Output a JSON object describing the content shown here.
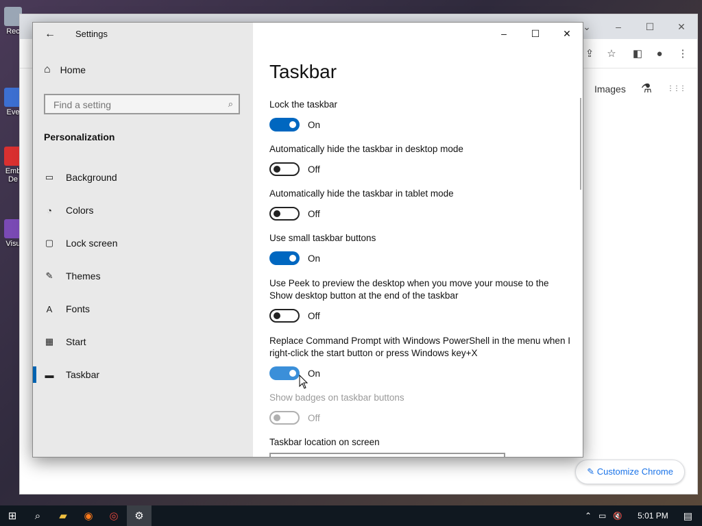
{
  "desktop": {
    "icons": [
      {
        "label": "Rec",
        "color": "#9aa6b5"
      },
      {
        "label": "Eve",
        "color": "#3c6fd1"
      },
      {
        "label": "Emb",
        "color": "#d93030"
      },
      {
        "label": "De",
        "color": "#d93030"
      },
      {
        "label": "Visu",
        "color": "#7a4ab5"
      }
    ]
  },
  "chrome": {
    "window_controls": {
      "min": "–",
      "max": "☐",
      "close": "✕",
      "chevron": "⌄"
    },
    "toolbar_icons": {
      "share": "⇪",
      "star": "☆",
      "sidepanel": "◧",
      "profile": "●",
      "menu": "⋮"
    },
    "links": {
      "images": "Images",
      "labs": "⚗",
      "apps": "⋮⋮⋮"
    },
    "customize_label": "Customize Chrome",
    "accent": "#1a73e8"
  },
  "settings": {
    "window_title": "Settings",
    "window_controls": {
      "min": "–",
      "max": "☐",
      "close": "✕"
    },
    "back_icon": "←",
    "home_label": "Home",
    "home_icon": "⌂",
    "search_placeholder": "Find a setting",
    "search_icon": "⌕",
    "section_title": "Personalization",
    "nav": [
      {
        "label": "Background",
        "icon": "▭"
      },
      {
        "label": "Colors",
        "icon": "◔"
      },
      {
        "label": "Lock screen",
        "icon": "▢"
      },
      {
        "label": "Themes",
        "icon": "✎"
      },
      {
        "label": "Fonts",
        "icon": "A"
      },
      {
        "label": "Start",
        "icon": "▦"
      },
      {
        "label": "Taskbar",
        "icon": "▬"
      }
    ],
    "page_title": "Taskbar",
    "options": [
      {
        "label": "Lock the taskbar",
        "state": "On"
      },
      {
        "label": "Automatically hide the taskbar in desktop mode",
        "state": "Off"
      },
      {
        "label": "Automatically hide the taskbar in tablet mode",
        "state": "Off"
      },
      {
        "label": "Use small taskbar buttons",
        "state": "On"
      },
      {
        "label": "Use Peek to preview the desktop when you move your mouse to the Show desktop button at the end of the taskbar",
        "state": "Off"
      },
      {
        "label": "Replace Command Prompt with Windows PowerShell in the menu when I right-click the start button or press Windows key+X",
        "state": "On"
      },
      {
        "label": "Show badges on taskbar buttons",
        "state": "Off"
      }
    ],
    "location_label": "Taskbar location on screen",
    "accent": "#0067c0"
  },
  "taskbar": {
    "start_icon": "⊞",
    "search_icon": "⌕",
    "explorer_icon": "▰",
    "firefox_icon": "◉",
    "chrome_icon": "◎",
    "settings_icon": "⚙",
    "tray": {
      "chevron": "⌃",
      "network": "▭",
      "volume": "🔇",
      "time": "5:01 PM",
      "notifications": "▤"
    }
  }
}
